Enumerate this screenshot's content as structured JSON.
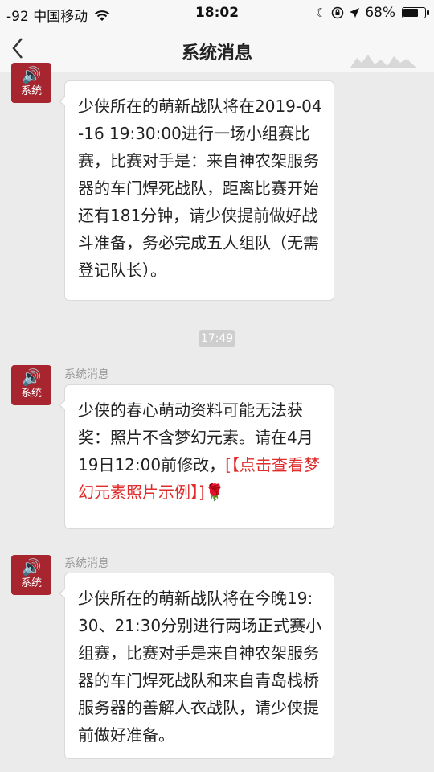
{
  "status_bar": {
    "signal": "-92",
    "carrier": "中国移动",
    "wifi_icon": "wifi-icon",
    "time": "18:02",
    "battery_percent": "68%",
    "battery_level": 0.68
  },
  "nav": {
    "title": "系统消息",
    "back_icon": "chevron-left-icon"
  },
  "avatar_label": "系统",
  "sender_name": "系统消息",
  "messages": [
    {
      "text": "少侠所在的萌新战队将在2019-04-16 19:30:00进行一场小组赛比赛，比赛对手是：来自神农架服务器的车门焊死战队，距离比赛开始还有181分钟，请少侠提前做好战斗准备，务必完成五人组队（无需登记队长）。"
    },
    {
      "timestamp": "17:49",
      "sender": "系统消息",
      "text_before": "少侠的春心萌动资料可能无法获奖：照片不含梦幻元素。请在4月19日12:00前修改，",
      "link_text": "[【点击查看梦幻元素照片示例】]",
      "emoji_icon": "rose-icon"
    },
    {
      "sender": "系统消息",
      "text": "少侠所在的萌新战队将在今晚19:30、21:30分别进行两场正式赛小组赛，比赛对手是来自神农架服务器的车门焊死战队和来自青岛栈桥服务器的善解人衣战队，请少侠提前做好准备。"
    }
  ],
  "colors": {
    "avatar_bg": "#a6252e",
    "link": "#e02b2b",
    "page_bg": "#ebebeb"
  }
}
